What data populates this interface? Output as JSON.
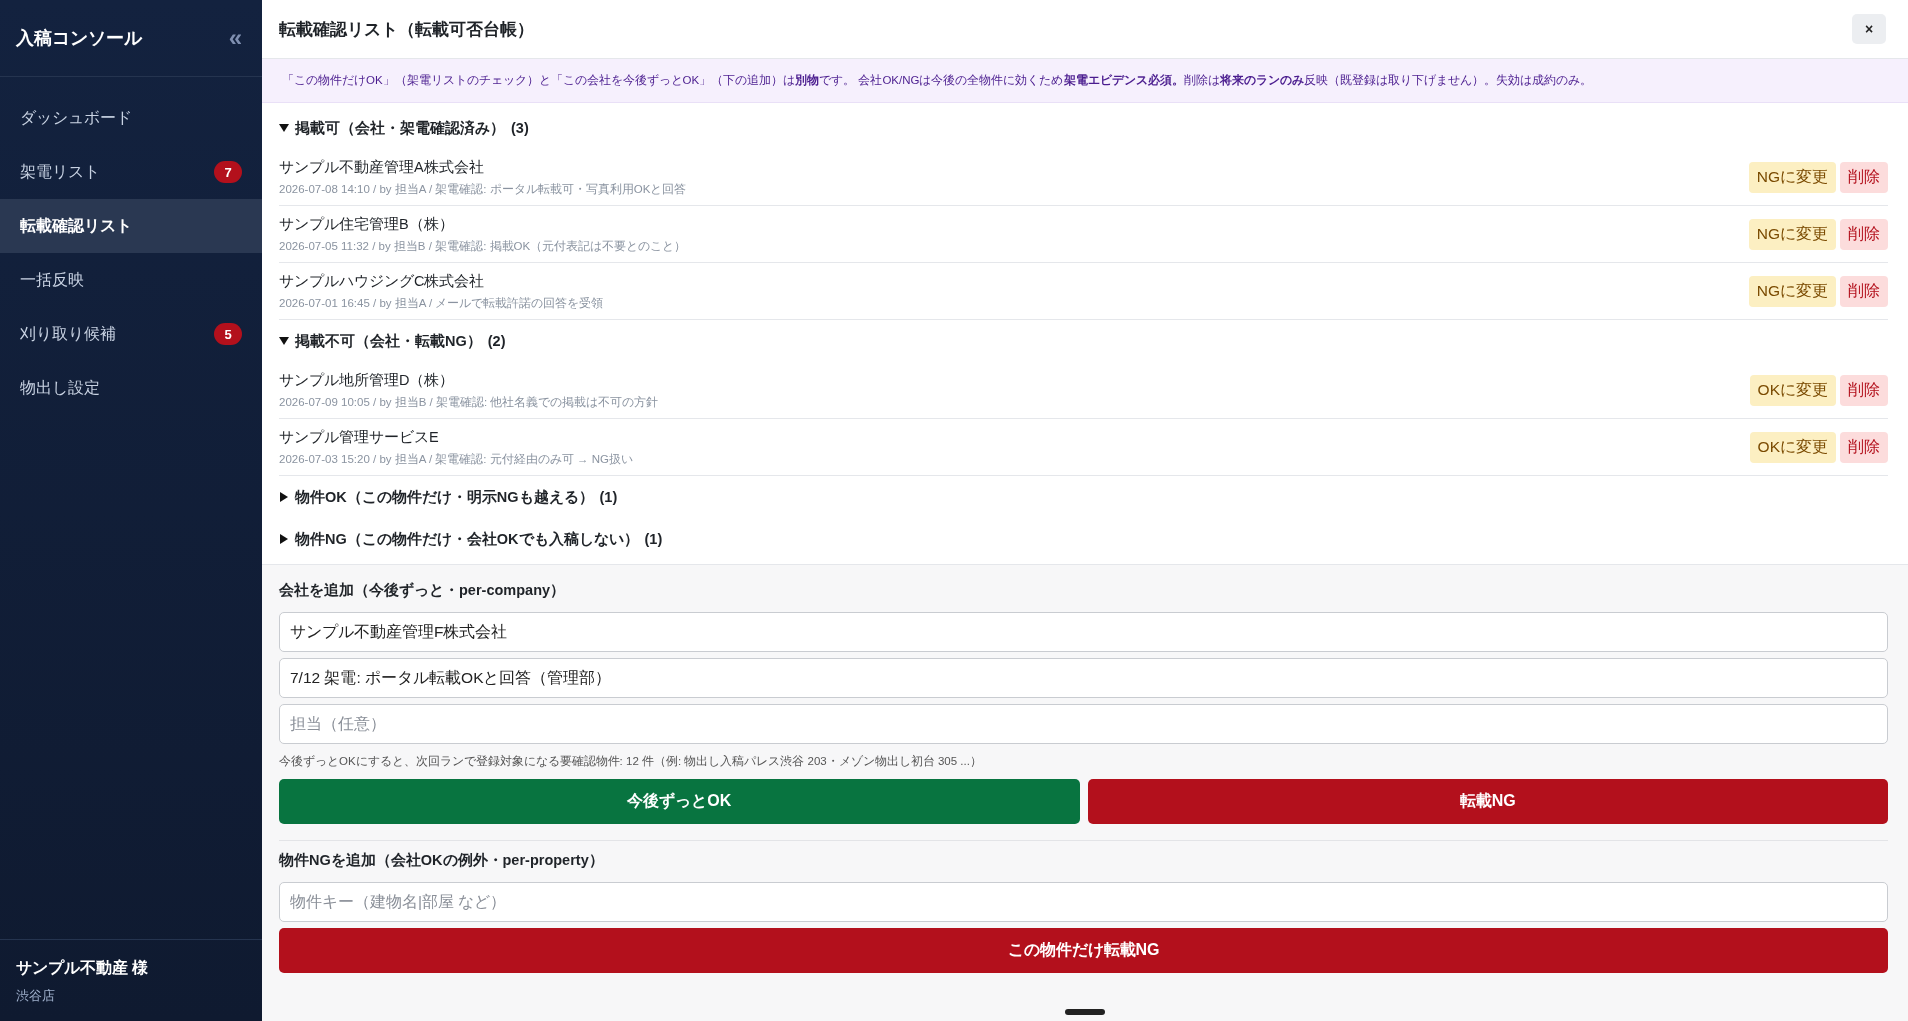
{
  "sidebar": {
    "title": "入稿コンソール",
    "collapse_icon": "«",
    "items": [
      {
        "label": "ダッシュボード",
        "selected": false
      },
      {
        "label": "架電リスト",
        "selected": false,
        "badge": "7"
      },
      {
        "label": "転載確認リスト",
        "selected": true
      },
      {
        "label": "一括反映",
        "selected": false
      },
      {
        "label": "刈り取り候補",
        "selected": false,
        "badge": "5"
      },
      {
        "label": "物出し設定",
        "selected": false
      }
    ],
    "footer": {
      "name": "サンプル不動産 様",
      "store": "渋谷店"
    }
  },
  "panel": {
    "title": "転載確認リスト（転載可否台帳）",
    "close": "×",
    "notice": "「この物件だけOK」（架電リストのチェック）と「この会社を今後ずっとOK」（下の追加）は**別物**です。 会社OK/NGは今後の全物件に効くため**架電エビデンス必須。**削除は**将来のランのみ**反映（既登録は取り下げません）。失効は成約のみ。",
    "sections": [
      {
        "title": "掲載可（会社・架電確認済み）",
        "count": "(3)",
        "expanded": true,
        "items": [
          {
            "name": "サンプル不動産管理A株式会社",
            "meta": "2026-07-08 14:10 / by 担当A / 架電確認: ポータル転載可・写真利用OKと回答",
            "action": "NGに変更",
            "delete": "削除"
          },
          {
            "name": "サンプル住宅管理B（株）",
            "meta": "2026-07-05 11:32 / by 担当B / 架電確認: 掲載OK（元付表記は不要とのこと）",
            "action": "NGに変更",
            "delete": "削除"
          },
          {
            "name": "サンプルハウジングC株式会社",
            "meta": "2026-07-01 16:45 / by 担当A / メールで転載許諾の回答を受領",
            "action": "NGに変更",
            "delete": "削除"
          }
        ]
      },
      {
        "title": "掲載不可（会社・転載NG）",
        "count": "(2)",
        "expanded": true,
        "items": [
          {
            "name": "サンプル地所管理D（株）",
            "meta": "2026-07-09 10:05 / by 担当B / 架電確認: 他社名義での掲載は不可の方針",
            "action": "OKに変更",
            "delete": "削除"
          },
          {
            "name": "サンプル管理サービスE",
            "meta": "2026-07-03 15:20 / by 担当A / 架電確認: 元付経由のみ可 → NG扱い",
            "action": "OKに変更",
            "delete": "削除"
          }
        ]
      },
      {
        "title": "物件OK（この物件だけ・明示NGも越える）",
        "count": "(1)",
        "expanded": false
      },
      {
        "title": "物件NG（この物件だけ・会社OKでも入稿しない）",
        "count": "(1)",
        "expanded": false
      }
    ],
    "forms": [
      {
        "title": "会社を追加（今後ずっと・per-company）",
        "fields": [
          {
            "value": "サンプル不動産管理F株式会社"
          },
          {
            "value": "7/12 架電: ポータル転載OKと回答（管理部）"
          },
          {
            "placeholder": "担当（任意）"
          }
        ],
        "note": "今後ずっとOKにすると、次回ランで登録対象になる要確認物件: 12 件（例: 物出し入稿パレス渋谷 203・メゾン物出し初台 305 ...）",
        "buttons": [
          {
            "label": "今後ずっとOK",
            "kind": "ok"
          },
          {
            "label": "転載NG",
            "kind": "ng"
          }
        ]
      },
      {
        "title": "物件NGを追加（会社OKの例外・per-property）",
        "fields": [
          {
            "placeholder": "物件キー（建物名|部屋 など）"
          }
        ],
        "buttons": [
          {
            "label": "この物件だけ転載NG",
            "kind": "ng"
          }
        ]
      }
    ]
  }
}
